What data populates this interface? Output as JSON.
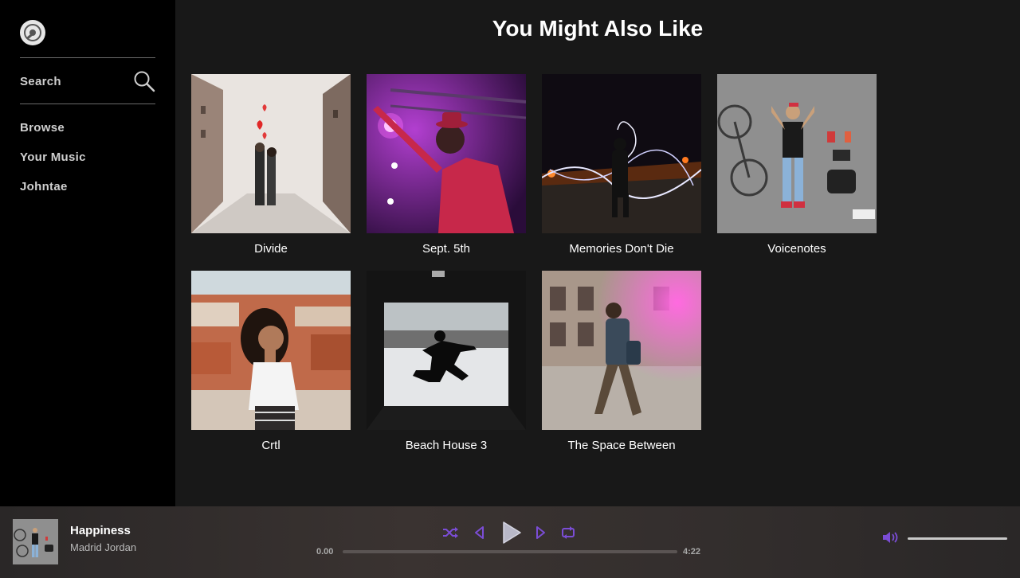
{
  "sidebar": {
    "logo_icon": "vinyl-record-icon",
    "search_label": "Search",
    "nav": [
      {
        "label": "Browse"
      },
      {
        "label": "Your Music"
      },
      {
        "label": "Johntae"
      }
    ]
  },
  "main": {
    "title": "You Might Also Like",
    "albums": [
      {
        "title": "Divide"
      },
      {
        "title": "Sept. 5th"
      },
      {
        "title": "Memories Don't Die"
      },
      {
        "title": "Voicenotes"
      },
      {
        "title": "Crtl"
      },
      {
        "title": "Beach House 3"
      },
      {
        "title": "The Space Between"
      }
    ]
  },
  "player": {
    "track_title": "Happiness",
    "artist": "Madrid Jordan",
    "current_time": "0.00",
    "total_time": "4:22",
    "progress": 0,
    "volume": 1.0,
    "accent_color": "#7b4dd6"
  }
}
